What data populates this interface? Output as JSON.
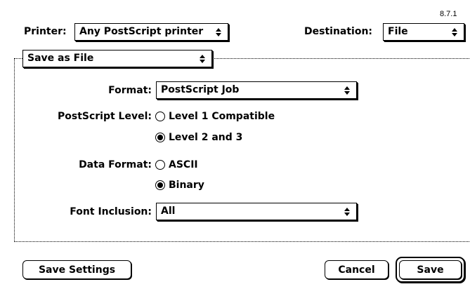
{
  "version": "8.7.1",
  "printer": {
    "label": "Printer:",
    "value": "Any PostScript printer",
    "arrows_icon": "popup-arrows-icon"
  },
  "destination": {
    "label": "Destination:",
    "value": "File"
  },
  "section_popup": {
    "value": "Save as File"
  },
  "format": {
    "label": "Format:",
    "value": "PostScript Job"
  },
  "postscript_level": {
    "label": "PostScript Level:",
    "options": [
      {
        "label": "Level 1 Compatible",
        "selected": false
      },
      {
        "label": "Level 2 and 3",
        "selected": true
      }
    ]
  },
  "data_format": {
    "label": "Data Format:",
    "options": [
      {
        "label": "ASCII",
        "selected": false
      },
      {
        "label": "Binary",
        "selected": true
      }
    ]
  },
  "font_inclusion": {
    "label": "Font Inclusion:",
    "value": "All"
  },
  "buttons": {
    "save_settings": "Save Settings",
    "cancel": "Cancel",
    "save": "Save"
  }
}
